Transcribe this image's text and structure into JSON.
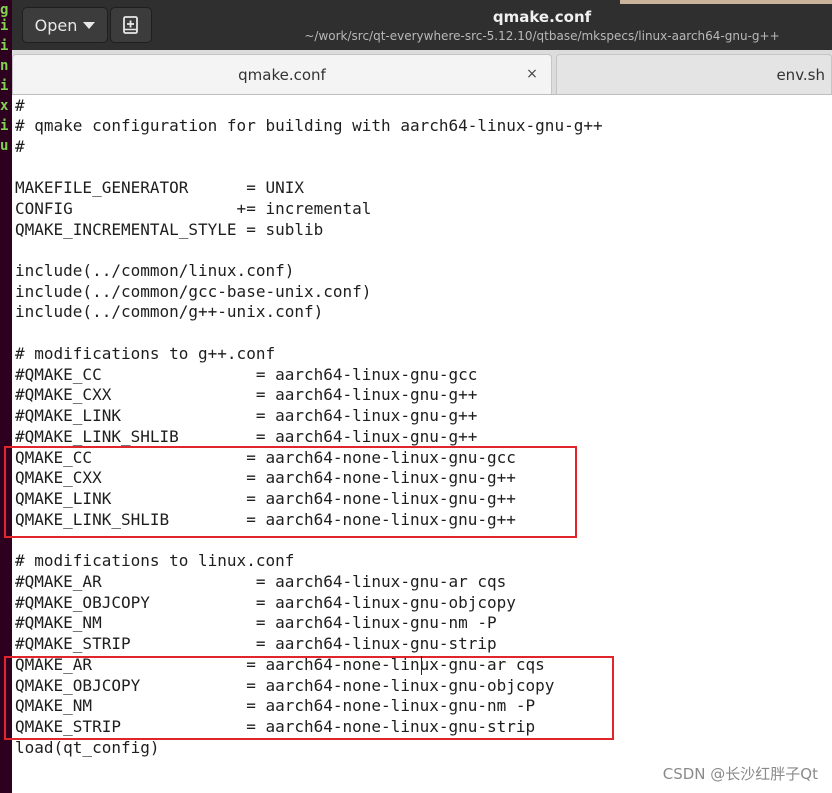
{
  "terminal": {
    "chars": [
      "g",
      "i",
      "i",
      "n",
      "i",
      "x",
      "i",
      "u"
    ]
  },
  "header": {
    "open_label": "Open",
    "title": "qmake.conf",
    "subtitle": "~/work/src/qt-everywhere-src-5.12.10/qtbase/mkspecs/linux-aarch64-gnu-g++"
  },
  "tabs": [
    {
      "label": "qmake.conf",
      "close": "×"
    },
    {
      "label": "env.sh"
    }
  ],
  "editor": {
    "lines": [
      "#",
      "# qmake configuration for building with aarch64-linux-gnu-g++",
      "#",
      "",
      "MAKEFILE_GENERATOR      = UNIX",
      "CONFIG                 += incremental",
      "QMAKE_INCREMENTAL_STYLE = sublib",
      "",
      "include(../common/linux.conf)",
      "include(../common/gcc-base-unix.conf)",
      "include(../common/g++-unix.conf)",
      "",
      "# modifications to g++.conf",
      "#QMAKE_CC                = aarch64-linux-gnu-gcc",
      "#QMAKE_CXX               = aarch64-linux-gnu-g++",
      "#QMAKE_LINK              = aarch64-linux-gnu-g++",
      "#QMAKE_LINK_SHLIB        = aarch64-linux-gnu-g++",
      "QMAKE_CC                = aarch64-none-linux-gnu-gcc",
      "QMAKE_CXX               = aarch64-none-linux-gnu-g++",
      "QMAKE_LINK              = aarch64-none-linux-gnu-g++",
      "QMAKE_LINK_SHLIB        = aarch64-none-linux-gnu-g++",
      "",
      "# modifications to linux.conf",
      "#QMAKE_AR                = aarch64-linux-gnu-ar cqs",
      "#QMAKE_OBJCOPY           = aarch64-linux-gnu-objcopy",
      "#QMAKE_NM                = aarch64-linux-gnu-nm -P",
      "#QMAKE_STRIP             = aarch64-linux-gnu-strip",
      "QMAKE_AR                = aarch64-none-linux-gnu-ar cqs",
      "QMAKE_OBJCOPY           = aarch64-none-linux-gnu-objcopy",
      "QMAKE_NM                = aarch64-none-linux-gnu-nm -P",
      "QMAKE_STRIP             = aarch64-none-linux-gnu-strip",
      "load(qt_config)"
    ]
  },
  "watermark": "CSDN @长沙红胖子Qt",
  "colors": {
    "header_bg": "#2f2f2f",
    "highlight_box": "#e0262b",
    "terminal_bg": "#2c001e",
    "terminal_text": "#7fd34e"
  }
}
